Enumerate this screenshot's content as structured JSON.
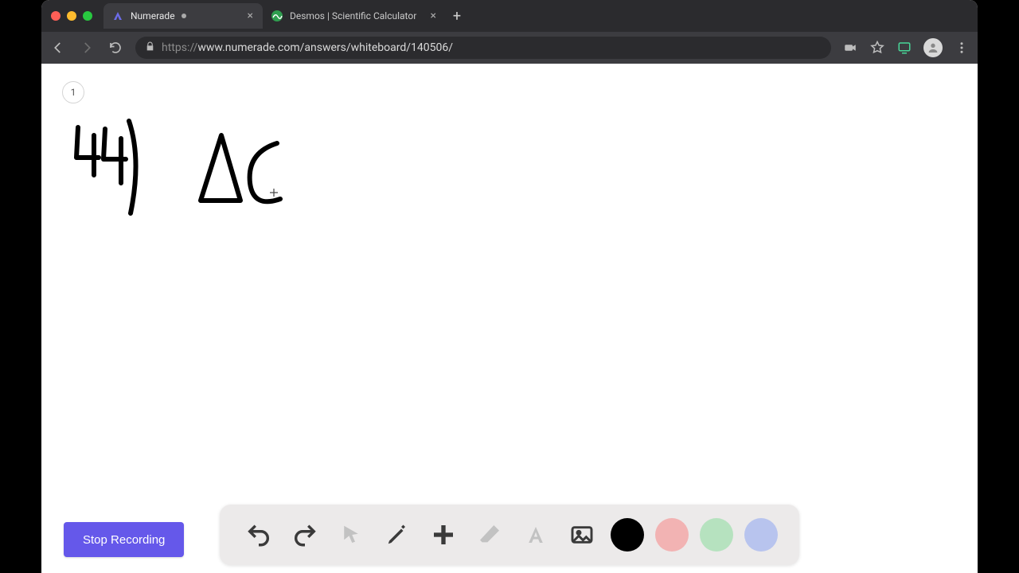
{
  "browser": {
    "tabs": [
      {
        "title": "Numerade",
        "active": true,
        "unsaved": true
      },
      {
        "title": "Desmos | Scientific Calculator",
        "active": false,
        "unsaved": false
      }
    ],
    "url": {
      "scheme": "https://",
      "rest": "www.numerade.com/answers/whiteboard/140506/"
    }
  },
  "whiteboard": {
    "page_number": "1",
    "stop_button_label": "Stop Recording",
    "toolbar": {
      "undo": "undo",
      "redo": "redo",
      "pointer": "pointer",
      "pen": "pen",
      "add": "add",
      "eraser": "eraser",
      "text": "text",
      "image": "image"
    },
    "colors": {
      "selected": "black",
      "options": [
        "black",
        "red",
        "green",
        "blue"
      ]
    }
  }
}
